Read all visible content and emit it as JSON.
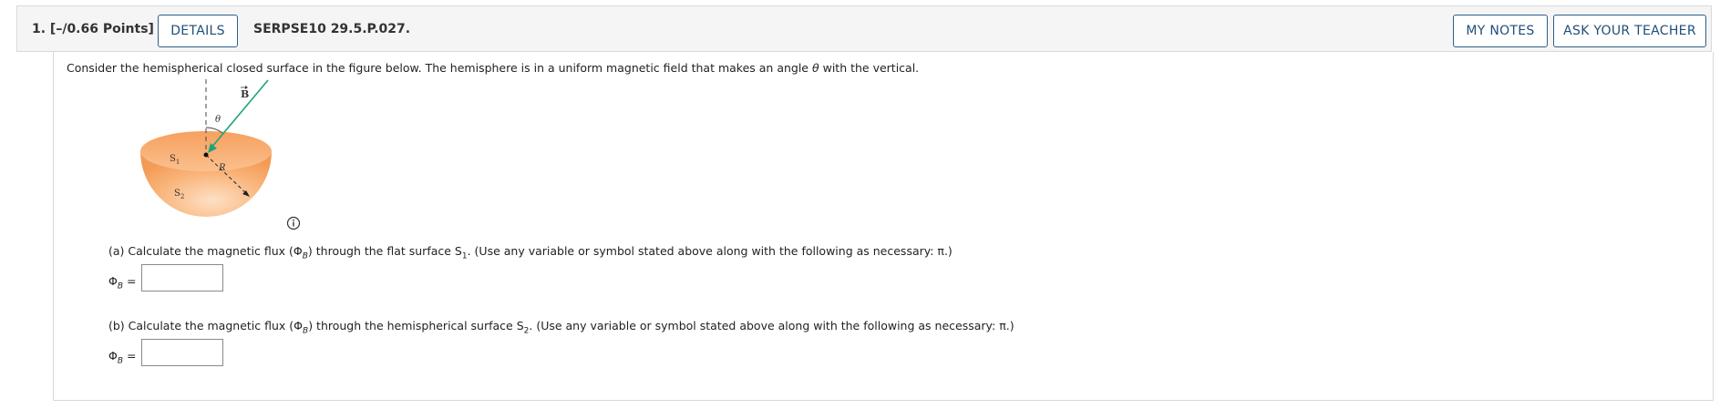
{
  "header": {
    "question_label": "1.  [–/0.66 Points]",
    "details_label": "DETAILS",
    "problem_code": "SERPSE10 29.5.P.027.",
    "my_notes_label": "MY NOTES",
    "ask_teacher_label": "ASK YOUR TEACHER"
  },
  "question": {
    "intro_before": "Consider the hemispherical closed surface in the figure below. The hemisphere is in a uniform magnetic field that makes an angle ",
    "intro_theta": "θ",
    "intro_after": " with the vertical.",
    "figure": {
      "field_label": "B",
      "angle_label": "θ",
      "radius_label": "R",
      "s1_label": "S",
      "s1_sub": "1",
      "s2_label": "S",
      "s2_sub": "2"
    },
    "part_a": {
      "text_before": "(a) Calculate the magnetic flux (Φ",
      "phi_sub": "B",
      "text_middle": ") through the flat surface S",
      "surface_sub": "1",
      "text_after": ". (Use any variable or symbol stated above along with the following as necessary: π.)",
      "answer_label": "Φ",
      "answer_sub": "B",
      "answer_eq": " =",
      "answer_value": ""
    },
    "part_b": {
      "text_before": "(b) Calculate the magnetic flux (Φ",
      "phi_sub": "B",
      "text_middle": ") through the hemispherical surface S",
      "surface_sub": "2",
      "text_after": ". (Use any variable or symbol stated above along with the following as necessary: π.)",
      "answer_label": "Φ",
      "answer_sub": "B",
      "answer_eq": " =",
      "answer_value": ""
    }
  },
  "colors": {
    "button_border": "#2d5f8a",
    "button_text": "#1f4e79",
    "header_bg": "#f5f5f5",
    "hemisphere_fill": "#f7a866",
    "field_arrow": "#1fa37a"
  },
  "icons": [
    "info-icon"
  ]
}
